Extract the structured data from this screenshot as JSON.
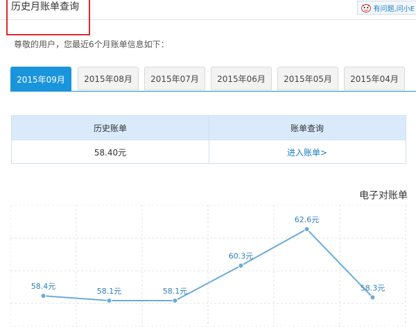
{
  "header": {
    "title": "历史月账单查询",
    "help_label": "有问题,问小E"
  },
  "intro_text": "尊敬的用户，您最近6个月账单信息如下：",
  "tabs": [
    {
      "label": "2015年09月",
      "active": true
    },
    {
      "label": "2015年08月",
      "active": false
    },
    {
      "label": "2015年07月",
      "active": false
    },
    {
      "label": "2015年06月",
      "active": false
    },
    {
      "label": "2015年05月",
      "active": false
    },
    {
      "label": "2015年04月",
      "active": false
    }
  ],
  "summary": {
    "col1_header": "历史账单",
    "col2_header": "账单查询",
    "amount": "58.40元",
    "enter_link": "进入账单>"
  },
  "ebill_title": "电子对账单",
  "colors": {
    "accent": "#1a95dc",
    "line": "#6aaad8",
    "highlight": "#e0262a"
  },
  "chart_data": {
    "type": "line",
    "series": [
      {
        "values": [
          58.4,
          58.1,
          58.1,
          60.3,
          62.6,
          58.3
        ],
        "labels": [
          "58.4元",
          "58.1元",
          "58.1元",
          "60.3元",
          "62.6元",
          "58.3元"
        ]
      }
    ],
    "grid": true
  }
}
